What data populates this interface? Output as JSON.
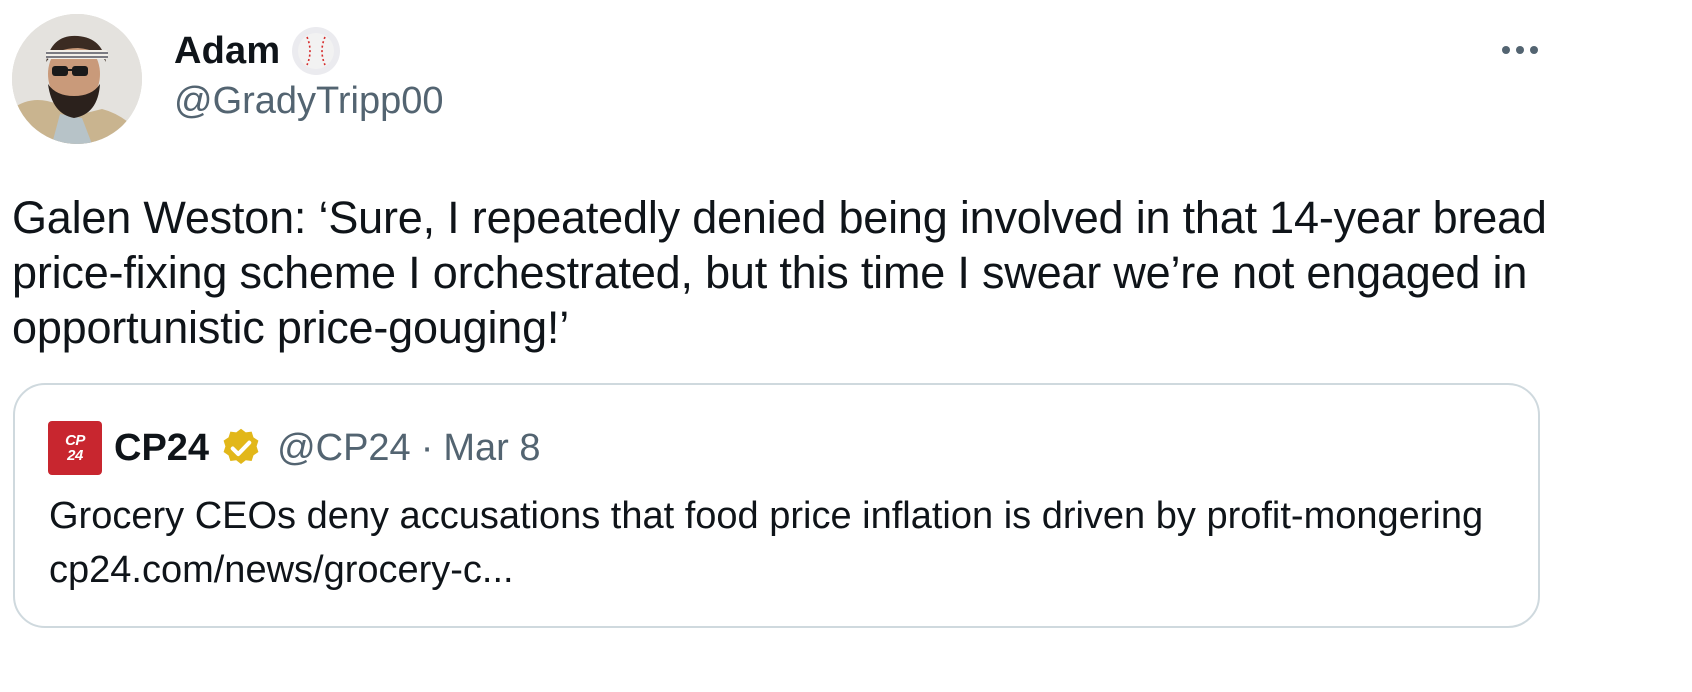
{
  "tweet": {
    "author": {
      "display_name": "Adam",
      "name_emoji": "baseball",
      "handle": "@GradyTripp00"
    },
    "text": "Galen Weston: ‘Sure, I repeatedly denied being involved in that 14-year bread price-fixing scheme I orchestrated, but this time I swear we’re not engaged in opportunistic price-gouging!’",
    "more_icon": "more-horizontal-icon"
  },
  "quote": {
    "logo_lines": [
      "CP",
      "24"
    ],
    "display_name": "CP24",
    "verified": "gold-verified-badge",
    "handle": "@CP24",
    "separator": "·",
    "date": "Mar 8",
    "text": "Grocery CEOs deny accusations that food price inflation is driven by profit-mongering cp24.com/news/grocery-c..."
  },
  "colors": {
    "text_primary": "#0f1419",
    "text_secondary": "#536471",
    "border": "#cfd9de",
    "cp24_red": "#c8262f",
    "verified_gold": "#e2b719"
  }
}
